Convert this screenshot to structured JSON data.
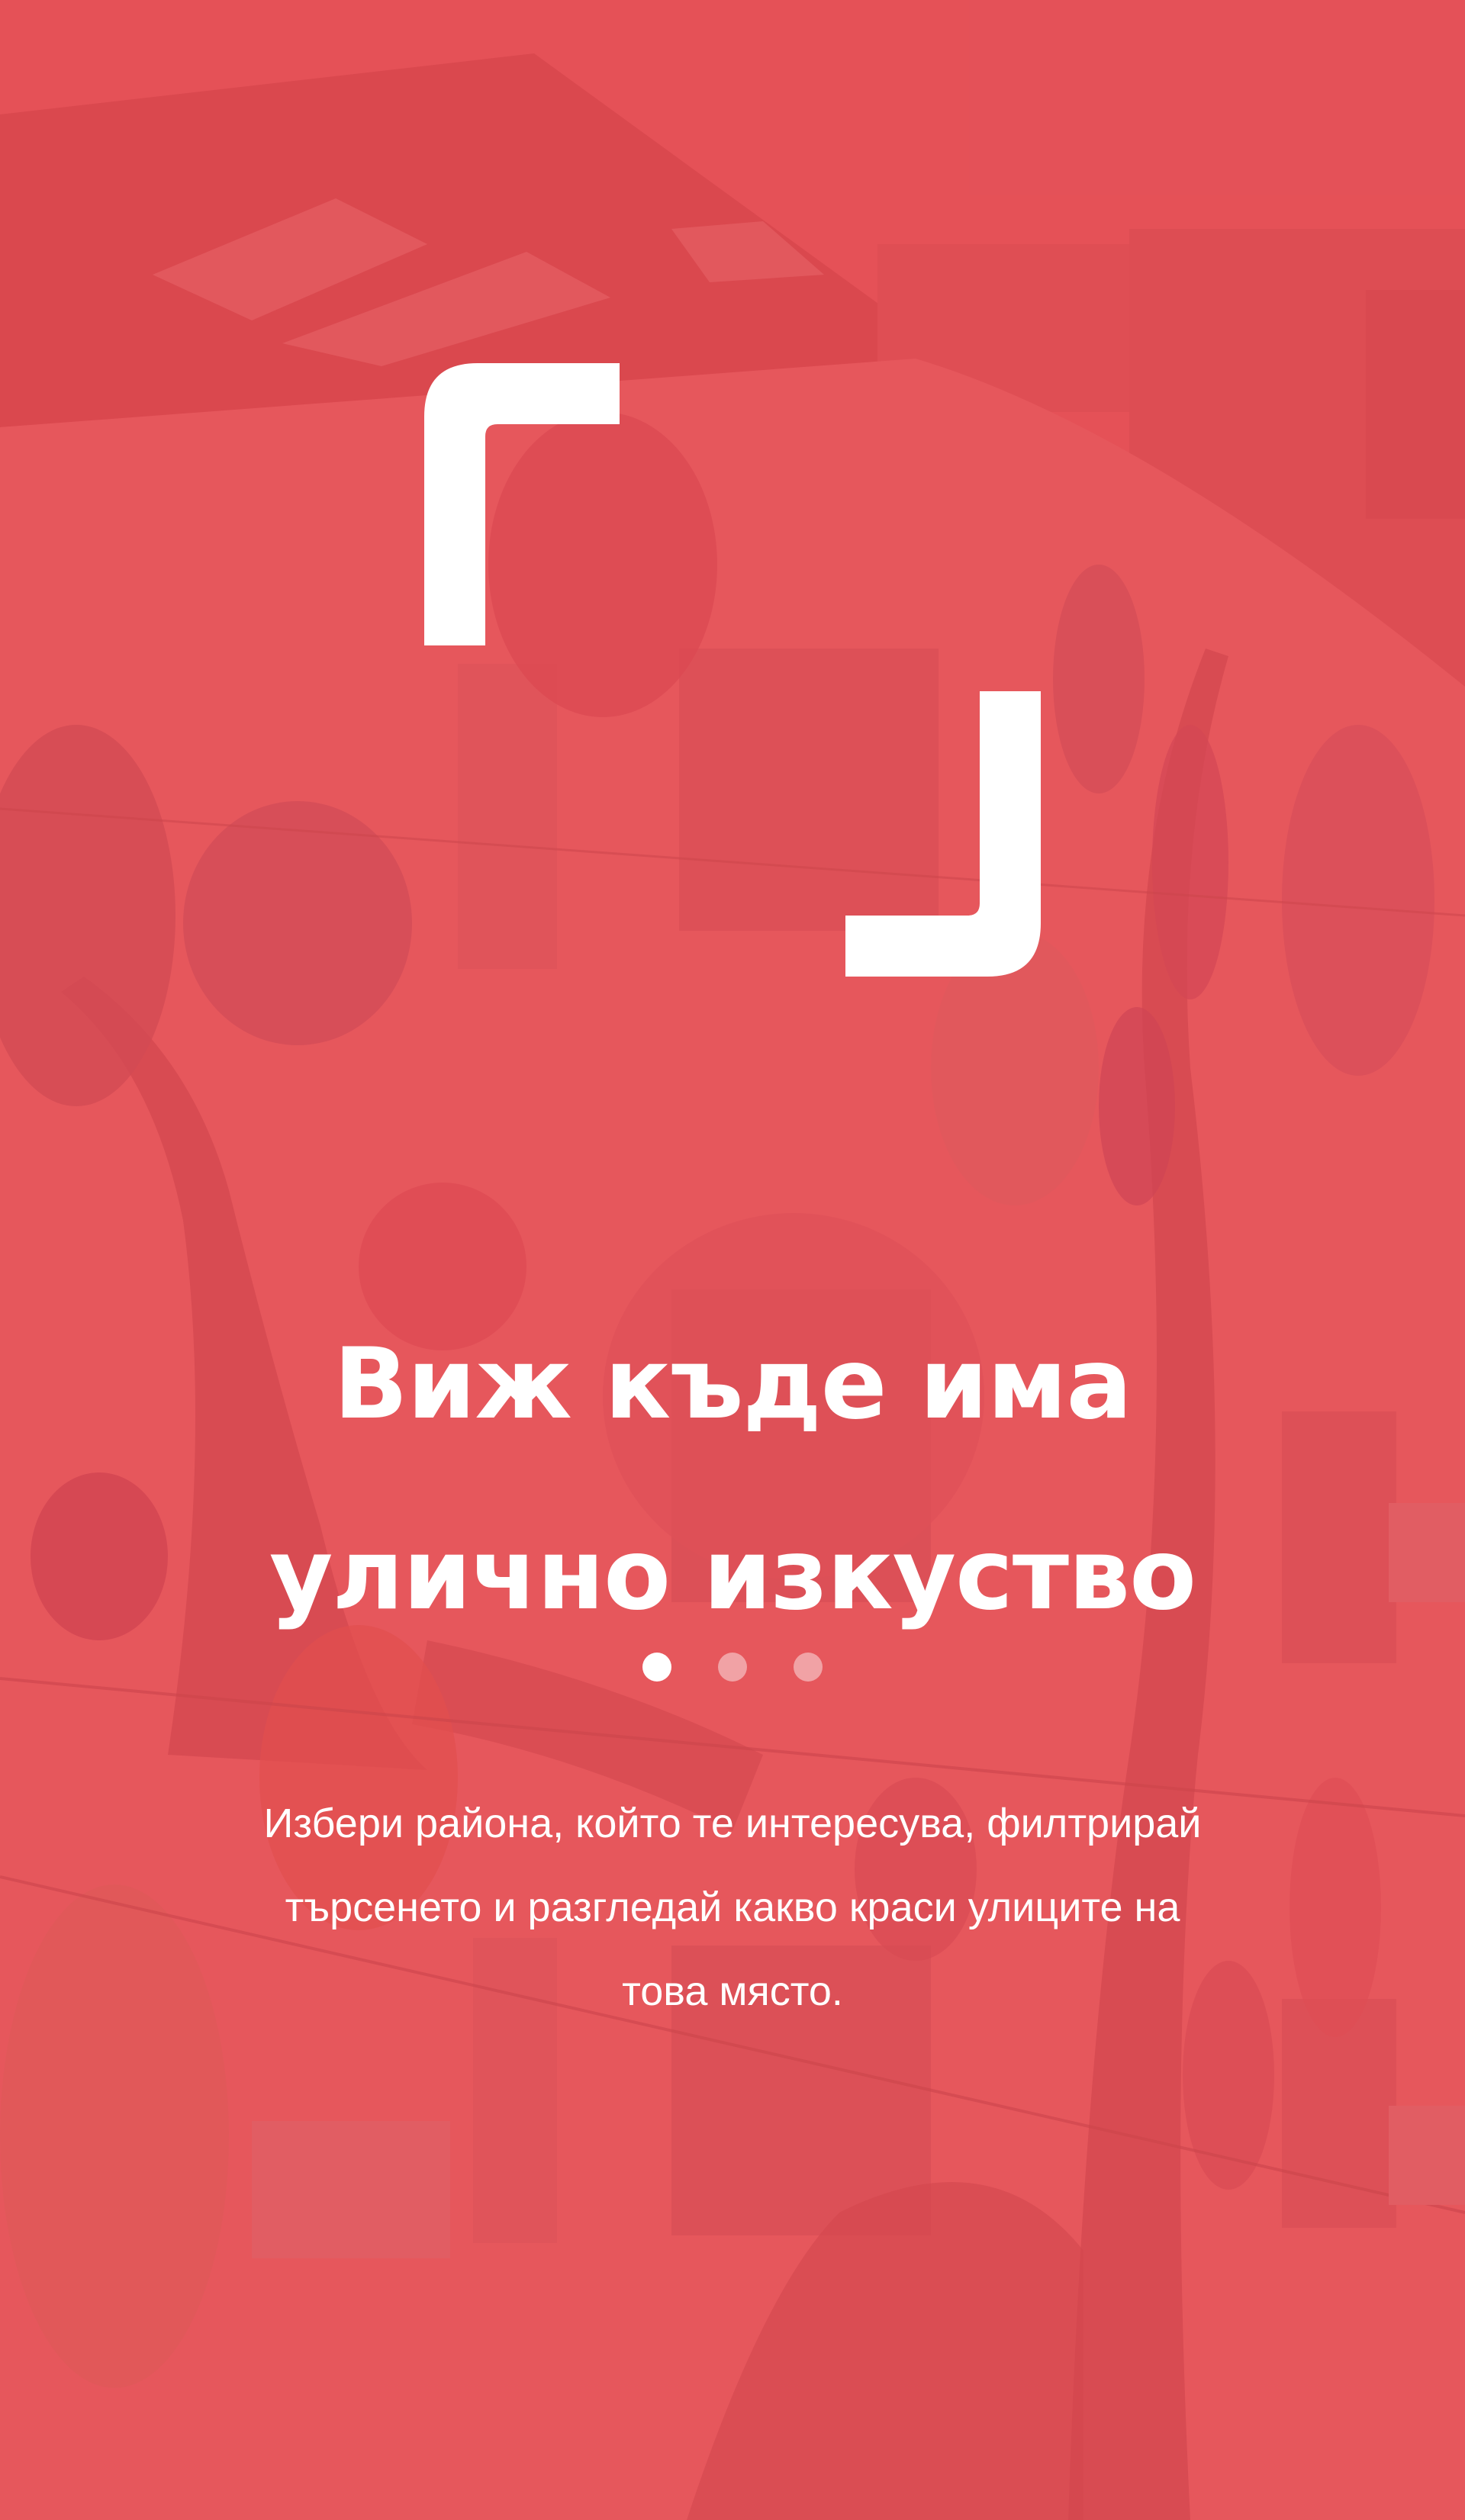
{
  "onboarding": {
    "logo_icon": "bracket-frame-logo",
    "headline_lines": [
      "Виж къде има",
      "улично изкуство"
    ],
    "pagination": {
      "total": 3,
      "active": 1
    },
    "description_lines": [
      "Избери района, който те интересува, филтрирай",
      "търсенето и разгледай какво краси улиците на",
      "това място."
    ],
    "colors": {
      "overlay": "#e94850",
      "text": "#ffffff"
    },
    "background_image": "building-with-street-art-mural"
  }
}
